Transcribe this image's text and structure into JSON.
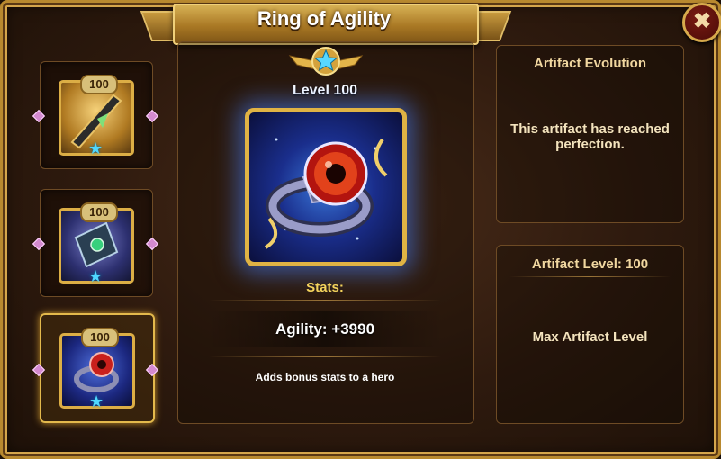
{
  "window": {
    "title": "Ring of Agility",
    "close_glyph": "✖"
  },
  "artifact_slots": [
    {
      "level": "100",
      "icon": "dagger-icon",
      "selected": false
    },
    {
      "level": "100",
      "icon": "spellbook-icon",
      "selected": false
    },
    {
      "level": "100",
      "icon": "ring-icon",
      "selected": true
    }
  ],
  "artifact": {
    "level_text": "Level 100",
    "stats_label": "Stats:",
    "stat_line": "Agility: +3990",
    "description": "Adds bonus stats to a hero",
    "icon": "ring-of-agility-icon"
  },
  "evolution_panel": {
    "heading": "Artifact Evolution",
    "message": "This artifact has reached perfection."
  },
  "level_panel": {
    "heading": "Artifact Level: 100",
    "message": "Max Artifact Level"
  },
  "colors": {
    "gold": "#dcae45",
    "star_blue": "#4fd8ff",
    "stat_yellow": "#f4d35c"
  }
}
